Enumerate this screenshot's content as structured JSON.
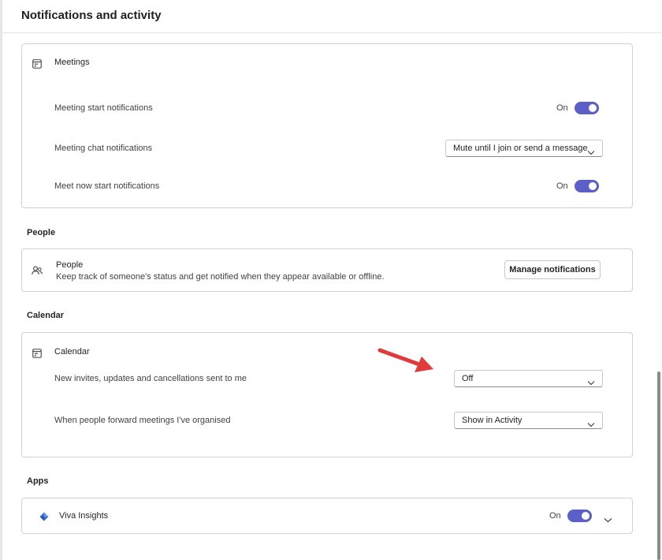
{
  "header": {
    "title": "Notifications and activity"
  },
  "meetings": {
    "title": "Meetings",
    "icon": "calendar-icon",
    "rows": {
      "start": {
        "label": "Meeting start notifications",
        "toggle_label": "On",
        "toggle_on": true
      },
      "chat": {
        "label": "Meeting chat notifications",
        "dropdown_value": "Mute until I join or send a message"
      },
      "meet_now": {
        "label": "Meet now start notifications",
        "toggle_label": "On",
        "toggle_on": true
      }
    }
  },
  "people": {
    "section_title": "People",
    "card_title": "People",
    "description": "Keep track of someone's status and get notified when they appear available or offline.",
    "button_label": "Manage notifications",
    "icon": "people-icon"
  },
  "calendar": {
    "section_title": "Calendar",
    "card_title": "Calendar",
    "icon": "calendar-icon",
    "rows": {
      "invites": {
        "label": "New invites, updates and cancellations sent to me",
        "dropdown_value": "Off"
      },
      "forward": {
        "label": "When people forward meetings I've organised",
        "dropdown_value": "Show in Activity"
      }
    }
  },
  "apps": {
    "section_title": "Apps",
    "viva": {
      "label": "Viva Insights",
      "toggle_label": "On",
      "toggle_on": true,
      "icon": "viva-insights-icon"
    }
  },
  "colors": {
    "accent": "#5b5fc7",
    "annotation_arrow": "#e03a3a"
  }
}
